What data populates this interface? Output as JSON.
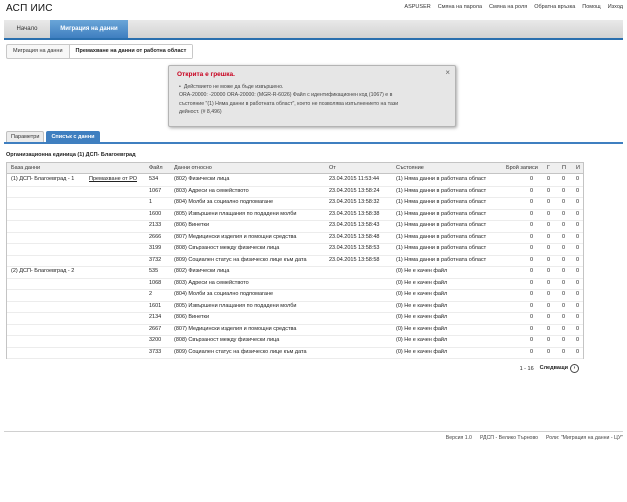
{
  "app": {
    "title": "АСП ИИС"
  },
  "toplinks": [
    "ASPUSER",
    "Смяна на парола",
    "Смяна на роля",
    "Обратна връзка",
    "Помощ",
    "Изход"
  ],
  "nav": {
    "home": "Начало",
    "active": "Миграция на данни"
  },
  "breadcrumb": {
    "first": "Миграция на данни",
    "current": "Премахване на данни от работна област"
  },
  "error": {
    "title": "Открита е грешка.",
    "lines": [
      "Действието не може да бъде извършено.",
      "ORA-20000: -20000 ORA-20000: (MGR-R-6026) Файл с идентификационен код (1067) е в",
      "състояние \"(1) Няма данни в работната област\", което не позволява изпълнението на тази",
      "дейност. (# 8,496)"
    ],
    "close_symbol": "×"
  },
  "subtabs": {
    "params": "Параметри",
    "list": "Списък с данни"
  },
  "org_unit": "Организационна единица (1) ДСП- Благоевград",
  "grid": {
    "headers": {
      "base": "База данни",
      "file": "Файл",
      "data": "Данни относно",
      "from": "От",
      "state": "Състояние",
      "count": "Брой записи",
      "g": "Г",
      "p": "П",
      "i": "И"
    },
    "rows": [
      {
        "base": "(1) ДСП- Благоевград - 1",
        "link": "Премахване от РО",
        "file": "534",
        "data": "(802) Физически лица",
        "from": "23.04.2015 11:53:44",
        "state": "(1) Няма данни в работната област",
        "count": "0",
        "g": "0",
        "p": "0",
        "i": "0"
      },
      {
        "base": "",
        "link": "",
        "file": "1067",
        "data": "(803) Адреси на семейството",
        "from": "23.04.2015 13:58:24",
        "state": "(1) Няма данни в работната област",
        "count": "0",
        "g": "0",
        "p": "0",
        "i": "0"
      },
      {
        "base": "",
        "link": "",
        "file": "1",
        "data": "(804) Молби за социално подпомагане",
        "from": "23.04.2015 13:58:32",
        "state": "(1) Няма данни в работната област",
        "count": "0",
        "g": "0",
        "p": "0",
        "i": "0"
      },
      {
        "base": "",
        "link": "",
        "file": "1600",
        "data": "(805) Извършени плащания по подадени молби",
        "from": "23.04.2015 13:58:38",
        "state": "(1) Няма данни в работната област",
        "count": "0",
        "g": "0",
        "p": "0",
        "i": "0"
      },
      {
        "base": "",
        "link": "",
        "file": "2133",
        "data": "(806) Винетки",
        "from": "23.04.2015 13:58:43",
        "state": "(1) Няма данни в работната област",
        "count": "0",
        "g": "0",
        "p": "0",
        "i": "0"
      },
      {
        "base": "",
        "link": "",
        "file": "2666",
        "data": "(807) Медицински изделия и помощни средства",
        "from": "23.04.2015 13:58:48",
        "state": "(1) Няма данни в работната област",
        "count": "0",
        "g": "0",
        "p": "0",
        "i": "0"
      },
      {
        "base": "",
        "link": "",
        "file": "3199",
        "data": "(808) Свързаност между физически лица",
        "from": "23.04.2015 13:58:53",
        "state": "(1) Няма данни в работната област",
        "count": "0",
        "g": "0",
        "p": "0",
        "i": "0"
      },
      {
        "base": "",
        "link": "",
        "file": "3732",
        "data": "(809) Социален статус на физическо лице към дата",
        "from": "23.04.2015 13:58:58",
        "state": "(1) Няма данни в работната област",
        "count": "0",
        "g": "0",
        "p": "0",
        "i": "0"
      },
      {
        "base": "(2) ДСП- Благоевград - 2",
        "link": "",
        "file": "535",
        "data": "(802) Физически лица",
        "from": "",
        "state": "(0) Не е качен файл",
        "count": "0",
        "g": "0",
        "p": "0",
        "i": "0"
      },
      {
        "base": "",
        "link": "",
        "file": "1068",
        "data": "(803) Адреси на семейството",
        "from": "",
        "state": "(0) Не е качен файл",
        "count": "0",
        "g": "0",
        "p": "0",
        "i": "0"
      },
      {
        "base": "",
        "link": "",
        "file": "2",
        "data": "(804) Молби за социално подпомагане",
        "from": "",
        "state": "(0) Не е качен файл",
        "count": "0",
        "g": "0",
        "p": "0",
        "i": "0"
      },
      {
        "base": "",
        "link": "",
        "file": "1601",
        "data": "(805) Извършени плащания по подадени молби",
        "from": "",
        "state": "(0) Не е качен файл",
        "count": "0",
        "g": "0",
        "p": "0",
        "i": "0"
      },
      {
        "base": "",
        "link": "",
        "file": "2134",
        "data": "(806) Винетки",
        "from": "",
        "state": "(0) Не е качен файл",
        "count": "0",
        "g": "0",
        "p": "0",
        "i": "0"
      },
      {
        "base": "",
        "link": "",
        "file": "2667",
        "data": "(807) Медицински изделия и помощни средства",
        "from": "",
        "state": "(0) Не е качен файл",
        "count": "0",
        "g": "0",
        "p": "0",
        "i": "0"
      },
      {
        "base": "",
        "link": "",
        "file": "3200",
        "data": "(808) Свързаност между физически лица",
        "from": "",
        "state": "(0) Не е качен файл",
        "count": "0",
        "g": "0",
        "p": "0",
        "i": "0"
      },
      {
        "base": "",
        "link": "",
        "file": "3733",
        "data": "(809) Социален статус на физическо лице към дата",
        "from": "",
        "state": "(0) Не е качен файл",
        "count": "0",
        "g": "0",
        "p": "0",
        "i": "0"
      }
    ]
  },
  "pager": {
    "range": "1 - 16",
    "next": "Следващи",
    "next_symbol": "›"
  },
  "footer": {
    "version": "Версия 1.0",
    "office": "РДСП - Велико Търново",
    "roles": "Роли: \"Миграция на данни - ЦУ\""
  },
  "colors": {
    "accent": "#3f7fc0",
    "error": "#c8001e"
  }
}
